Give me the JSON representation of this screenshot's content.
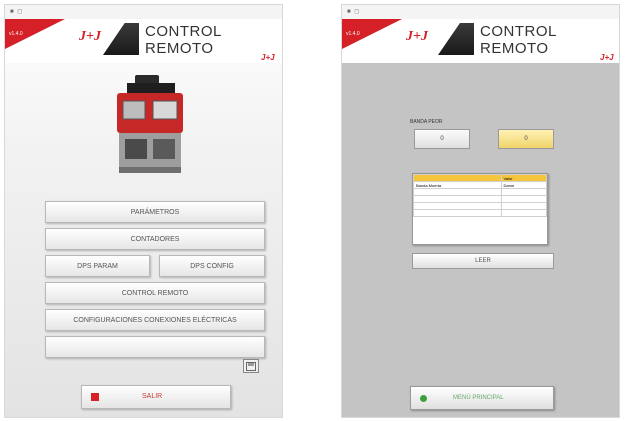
{
  "screen1": {
    "window_controls": "■ ◻",
    "version": "v1.4.0",
    "logo": "J+J",
    "title": "CONTROL REMOTO",
    "subtitle": "J+J",
    "buttons": {
      "parametros": "PARÁMETROS",
      "contadores": "CONTADORES",
      "dps_param": "DPS PARAM",
      "dps_config": "DPS CONFIG",
      "control_remoto": "CONTROL REMOTO",
      "configuraciones": "CONFIGURACIONES CONEXIONES ELÉCTRICAS",
      "empty": ""
    },
    "salir": "SALIR"
  },
  "screen2": {
    "window_controls": "■ ◻",
    "version": "v1.4.0",
    "logo": "J+J",
    "title": "CONTROL REMOTO",
    "subtitle": "J+J",
    "section_label": "BANDA PEOR",
    "btn_left": "0",
    "btn_right": "0",
    "table": {
      "headers": [
        "",
        "Valor"
      ],
      "rows": [
        [
          "Banda Muerta",
          "Dame"
        ],
        [
          "",
          ""
        ],
        [
          "",
          ""
        ],
        [
          "",
          ""
        ],
        [
          "",
          ""
        ]
      ]
    },
    "leer": "LEER",
    "menu": "MENÚ PRINCIPAL"
  },
  "colors": {
    "brand_red": "#d52027",
    "accent_yellow": "#f5c63b",
    "menu_green": "#3ca03c"
  }
}
